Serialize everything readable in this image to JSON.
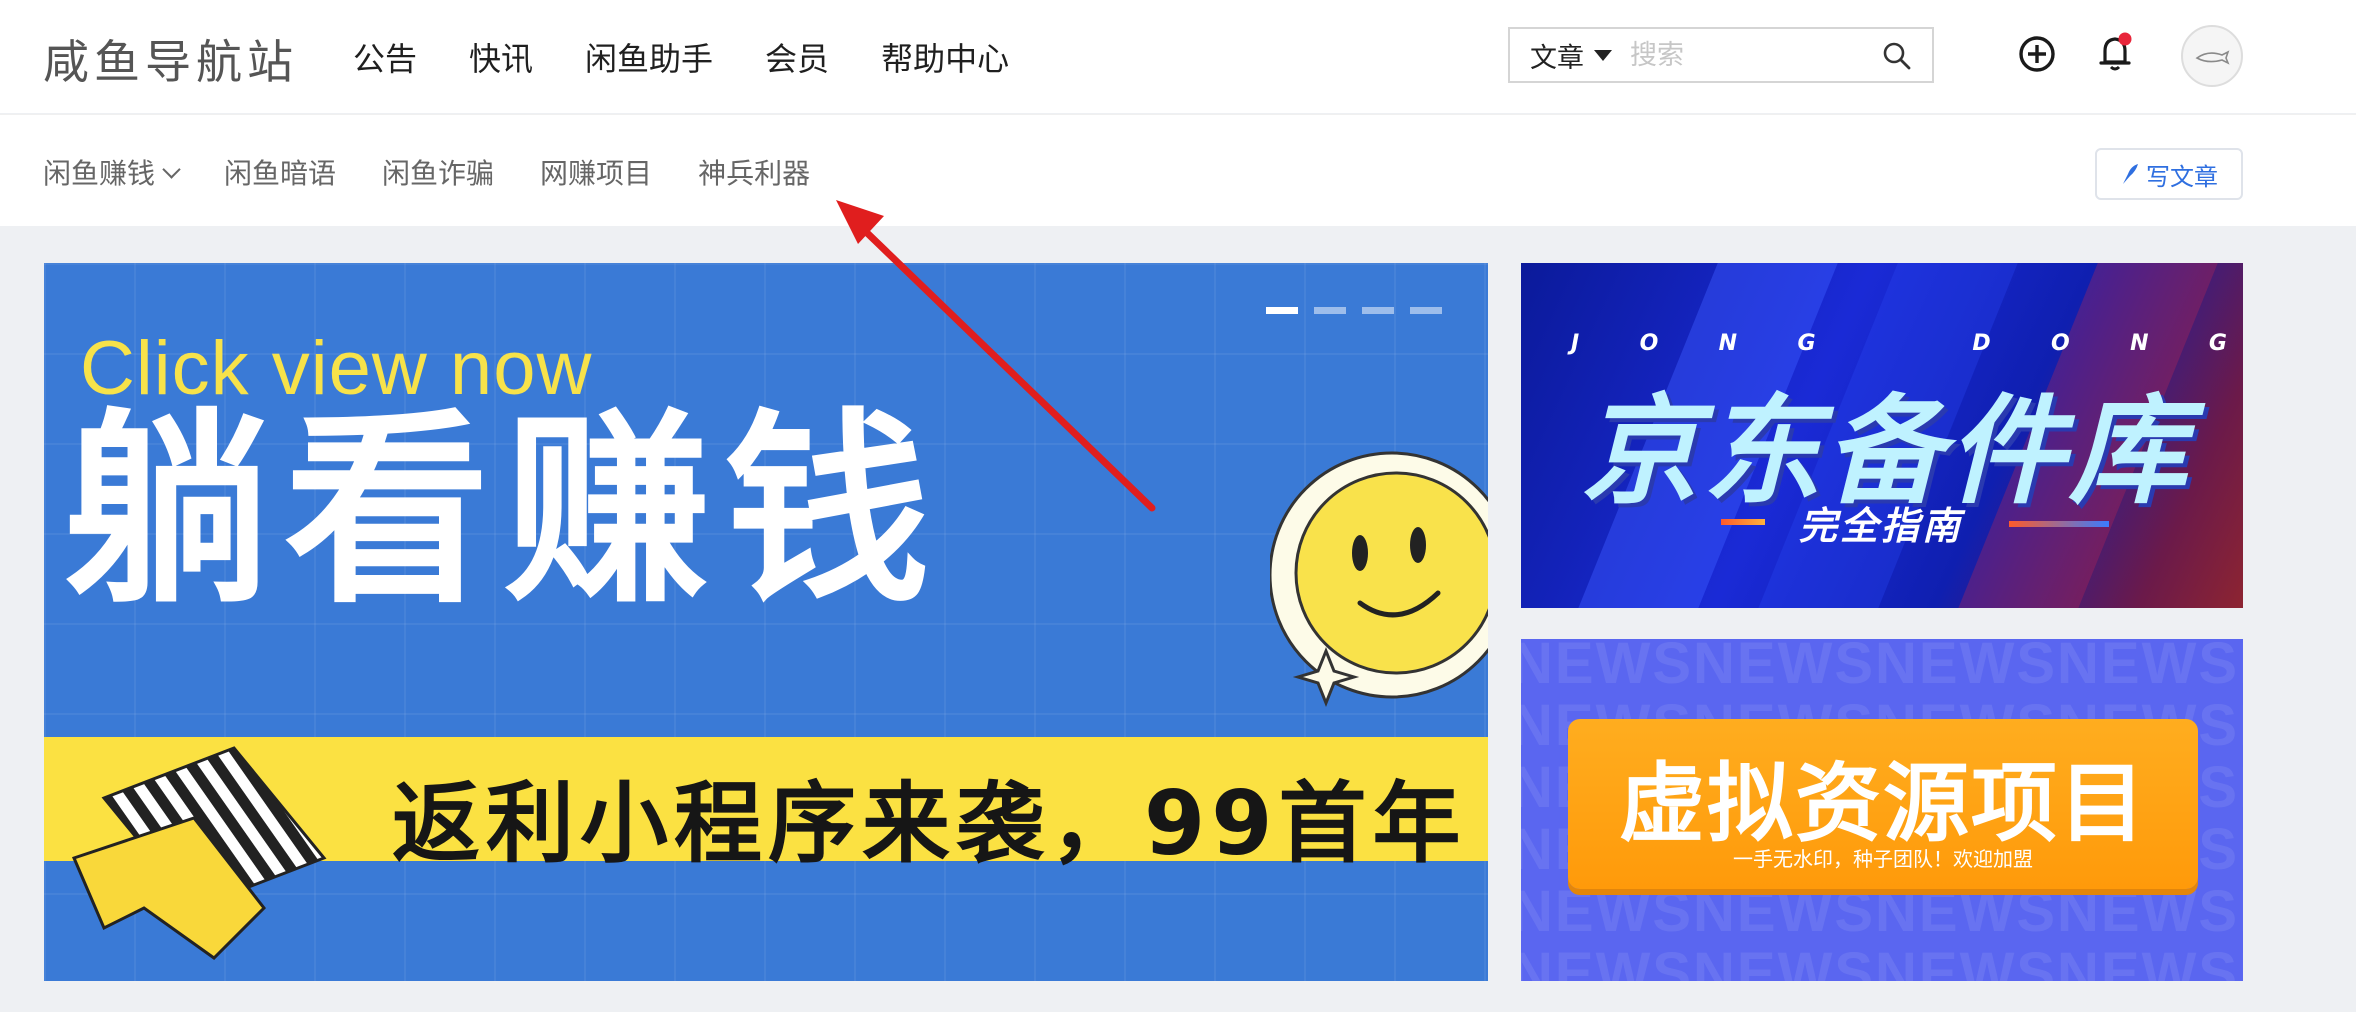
{
  "header": {
    "logo": "咸鱼导航站",
    "nav": [
      "公告",
      "快讯",
      "闲鱼助手",
      "会员",
      "帮助中心"
    ],
    "search": {
      "type_label": "文章",
      "placeholder": "搜索"
    },
    "notification_dot_color": "#e8253a"
  },
  "category_bar": {
    "items": [
      "闲鱼赚钱",
      "闲鱼暗语",
      "闲鱼诈骗",
      "网赚项目",
      "神兵利器"
    ],
    "write_button": "写文章"
  },
  "carousel": {
    "subtitle": "Click view now",
    "title": "躺看赚钱",
    "slogan": "返利小程序来袭，99首年",
    "slide_count": 4,
    "active_slide": 1
  },
  "side_banners": {
    "jd": {
      "letters": [
        "J",
        "O",
        "N",
        "G",
        "D",
        "O",
        "N",
        "G"
      ],
      "title": "京东备件库",
      "subtitle": "完全指南"
    },
    "virtual": {
      "title": "虚拟资源项目",
      "subtitle": "一手无水印，种子团队！欢迎加盟",
      "background_text": "NEWS"
    }
  },
  "colors": {
    "accent_blue": "#2f6fe0",
    "annotation_arrow": "#e01e1e"
  }
}
